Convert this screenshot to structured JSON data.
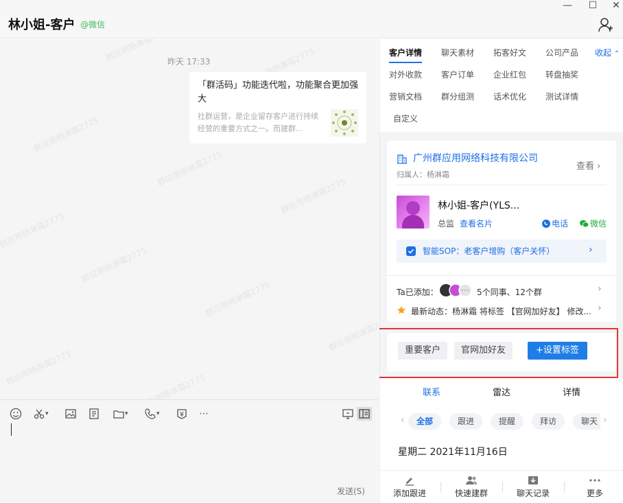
{
  "header": {
    "title": "林小姐-客户",
    "source_tag": "@微信",
    "window_controls": [
      "—",
      "☐",
      "✕"
    ]
  },
  "chat": {
    "watermark_text": "群应用杨淋霜2775",
    "time": "昨天 17:33",
    "card": {
      "title": "「群活码」功能迭代啦，功能聚合更加强大",
      "desc": "社群运营，是企业留存客户进行持续经营的重要方式之一。而建群..."
    }
  },
  "input": {
    "send_label": "发送(S)"
  },
  "right": {
    "tabs": [
      {
        "label": "客户详情",
        "active": true
      },
      {
        "label": "聊天素材"
      },
      {
        "label": "拓客好文"
      },
      {
        "label": "公司产品"
      },
      {
        "label": "对外收款"
      },
      {
        "label": "客户订单"
      },
      {
        "label": "企业红包"
      },
      {
        "label": "转盘抽奖"
      },
      {
        "label": "营销文档"
      },
      {
        "label": "群分组测"
      },
      {
        "label": "话术优化"
      },
      {
        "label": "测试详情"
      },
      {
        "label": "自定义"
      }
    ],
    "collapse_label": "收起",
    "company": "广州群应用网络科技有限公司",
    "view_label": "查看",
    "owner": "归属人：杨淋霜",
    "contact": {
      "name": "林小姐-客户(YLS...",
      "position": "总监",
      "card_link": "查看名片",
      "phone_label": "电话",
      "wechat_label": "微信"
    },
    "sop": "智能SOP：老客户增购（客户关怀）",
    "added_label": "Ta已添加：",
    "added_count": "5个同事、12个群",
    "dynamic": "最新动态：杨淋霜 将标签 【官网加好友】 修改...",
    "tags": [
      "重要客户",
      "官网加好友"
    ],
    "add_tag_label": "+设置标签",
    "sub_tabs": [
      {
        "label": "联系",
        "active": true
      },
      {
        "label": "雷达"
      },
      {
        "label": "详情"
      }
    ],
    "pills": [
      {
        "label": "全部",
        "active": true
      },
      {
        "label": "跟进"
      },
      {
        "label": "提醒"
      },
      {
        "label": "拜访"
      },
      {
        "label": "聊天"
      }
    ],
    "date": "星期二 2021年11月16日",
    "bottom_actions": [
      {
        "label": "添加跟进",
        "icon": "pen-icon"
      },
      {
        "label": "快速建群",
        "icon": "group-icon"
      },
      {
        "label": "聊天记录",
        "icon": "download-icon"
      },
      {
        "label": "更多",
        "icon": "more-icon"
      }
    ]
  },
  "colors": {
    "accent": "#1f6fe5",
    "wechat_green": "#22ad38",
    "highlight_red": "#e53333"
  }
}
